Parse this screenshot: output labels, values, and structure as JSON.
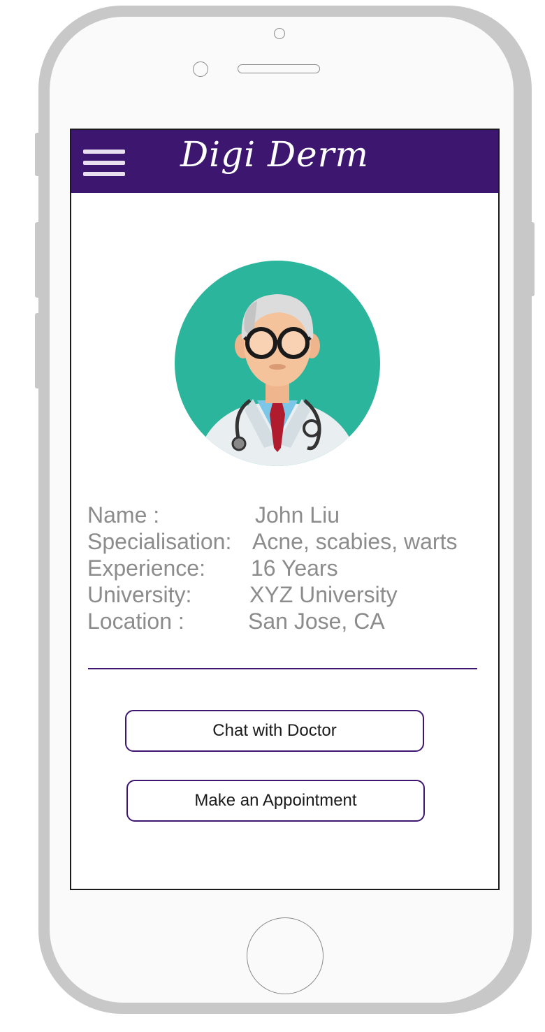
{
  "app": {
    "title": "Digi Derm",
    "brand_color": "#3d1670"
  },
  "header": {
    "menu_icon": "hamburger-menu-icon"
  },
  "doctor": {
    "avatar_icon": "doctor-avatar-icon",
    "avatar_bg_color": "#2bb59c",
    "fields": [
      {
        "label": "Name :",
        "value": "John Liu"
      },
      {
        "label": "Specialisation:",
        "value": "Acne, scabies, warts"
      },
      {
        "label": "Experience:",
        "value": "16 Years"
      },
      {
        "label": "University:",
        "value": "XYZ University"
      },
      {
        "label": "Location :",
        "value": "San Jose, CA"
      }
    ]
  },
  "actions": {
    "chat_label": "Chat with Doctor",
    "appointment_label": "Make an Appointment"
  }
}
